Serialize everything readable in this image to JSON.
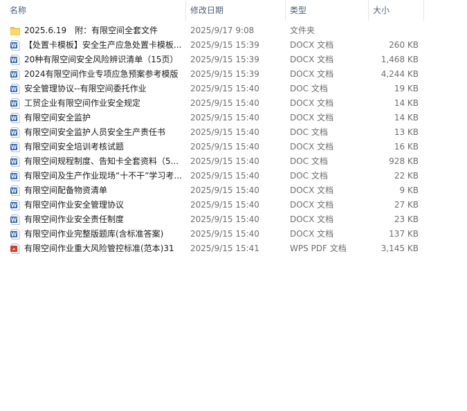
{
  "columns": {
    "name": "名称",
    "date": "修改日期",
    "type": "类型",
    "size": "大小"
  },
  "files": [
    {
      "name": "2025.6.19　附：有限空间全套文件",
      "date": "2025/9/17 9:08",
      "type": "文件夹",
      "size": "",
      "icon": "folder-icon"
    },
    {
      "name": "【处置卡模板】安全生产应急处置卡模板...",
      "date": "2025/9/15 15:39",
      "type": "DOCX 文档",
      "size": "260 KB",
      "icon": "word-icon"
    },
    {
      "name": "20种有限空间安全风险辨识清单（15页）",
      "date": "2025/9/15 15:39",
      "type": "DOCX 文档",
      "size": "1,468 KB",
      "icon": "word-icon"
    },
    {
      "name": "2024有限空间作业专项应急预案参考模版",
      "date": "2025/9/15 15:39",
      "type": "DOCX 文档",
      "size": "4,244 KB",
      "icon": "word-icon"
    },
    {
      "name": "安全管理协议--有限空间委托作业",
      "date": "2025/9/15 15:40",
      "type": "DOC 文档",
      "size": "19 KB",
      "icon": "word-icon"
    },
    {
      "name": "工贸企业有限空间作业安全规定",
      "date": "2025/9/15 15:40",
      "type": "DOCX 文档",
      "size": "14 KB",
      "icon": "word-icon"
    },
    {
      "name": "有限空间安全监护",
      "date": "2025/9/15 15:40",
      "type": "DOCX 文档",
      "size": "14 KB",
      "icon": "word-icon"
    },
    {
      "name": "有限空间安全监护人员安全生产责任书",
      "date": "2025/9/15 15:40",
      "type": "DOC 文档",
      "size": "13 KB",
      "icon": "word-icon"
    },
    {
      "name": "有限空间安全培训考核试题",
      "date": "2025/9/15 15:40",
      "type": "DOCX 文档",
      "size": "16 KB",
      "icon": "word-icon"
    },
    {
      "name": "有限空间规程制度、告知卡全套资料（5...",
      "date": "2025/9/15 15:40",
      "type": "DOC 文档",
      "size": "928 KB",
      "icon": "word-icon"
    },
    {
      "name": "有限空间及生产作业现场“十不干”学习考...",
      "date": "2025/9/15 15:40",
      "type": "DOC 文档",
      "size": "22 KB",
      "icon": "word-icon"
    },
    {
      "name": "有限空间配备物资清单",
      "date": "2025/9/15 15:40",
      "type": "DOCX 文档",
      "size": "9 KB",
      "icon": "word-icon"
    },
    {
      "name": "有限空间作业安全管理协议",
      "date": "2025/9/15 15:40",
      "type": "DOCX 文档",
      "size": "27 KB",
      "icon": "word-icon"
    },
    {
      "name": "有限空间作业安全责任制度",
      "date": "2025/9/15 15:40",
      "type": "DOCX 文档",
      "size": "23 KB",
      "icon": "word-icon"
    },
    {
      "name": "有限空间作业完整版题库(含标准答案)",
      "date": "2025/9/15 15:40",
      "type": "DOCX 文档",
      "size": "137 KB",
      "icon": "word-icon"
    },
    {
      "name": "有限空间作业重大风险管控标准(范本)31",
      "date": "2025/9/15 15:41",
      "type": "WPS PDF 文档",
      "size": "3,145 KB",
      "icon": "pdf-icon"
    }
  ]
}
